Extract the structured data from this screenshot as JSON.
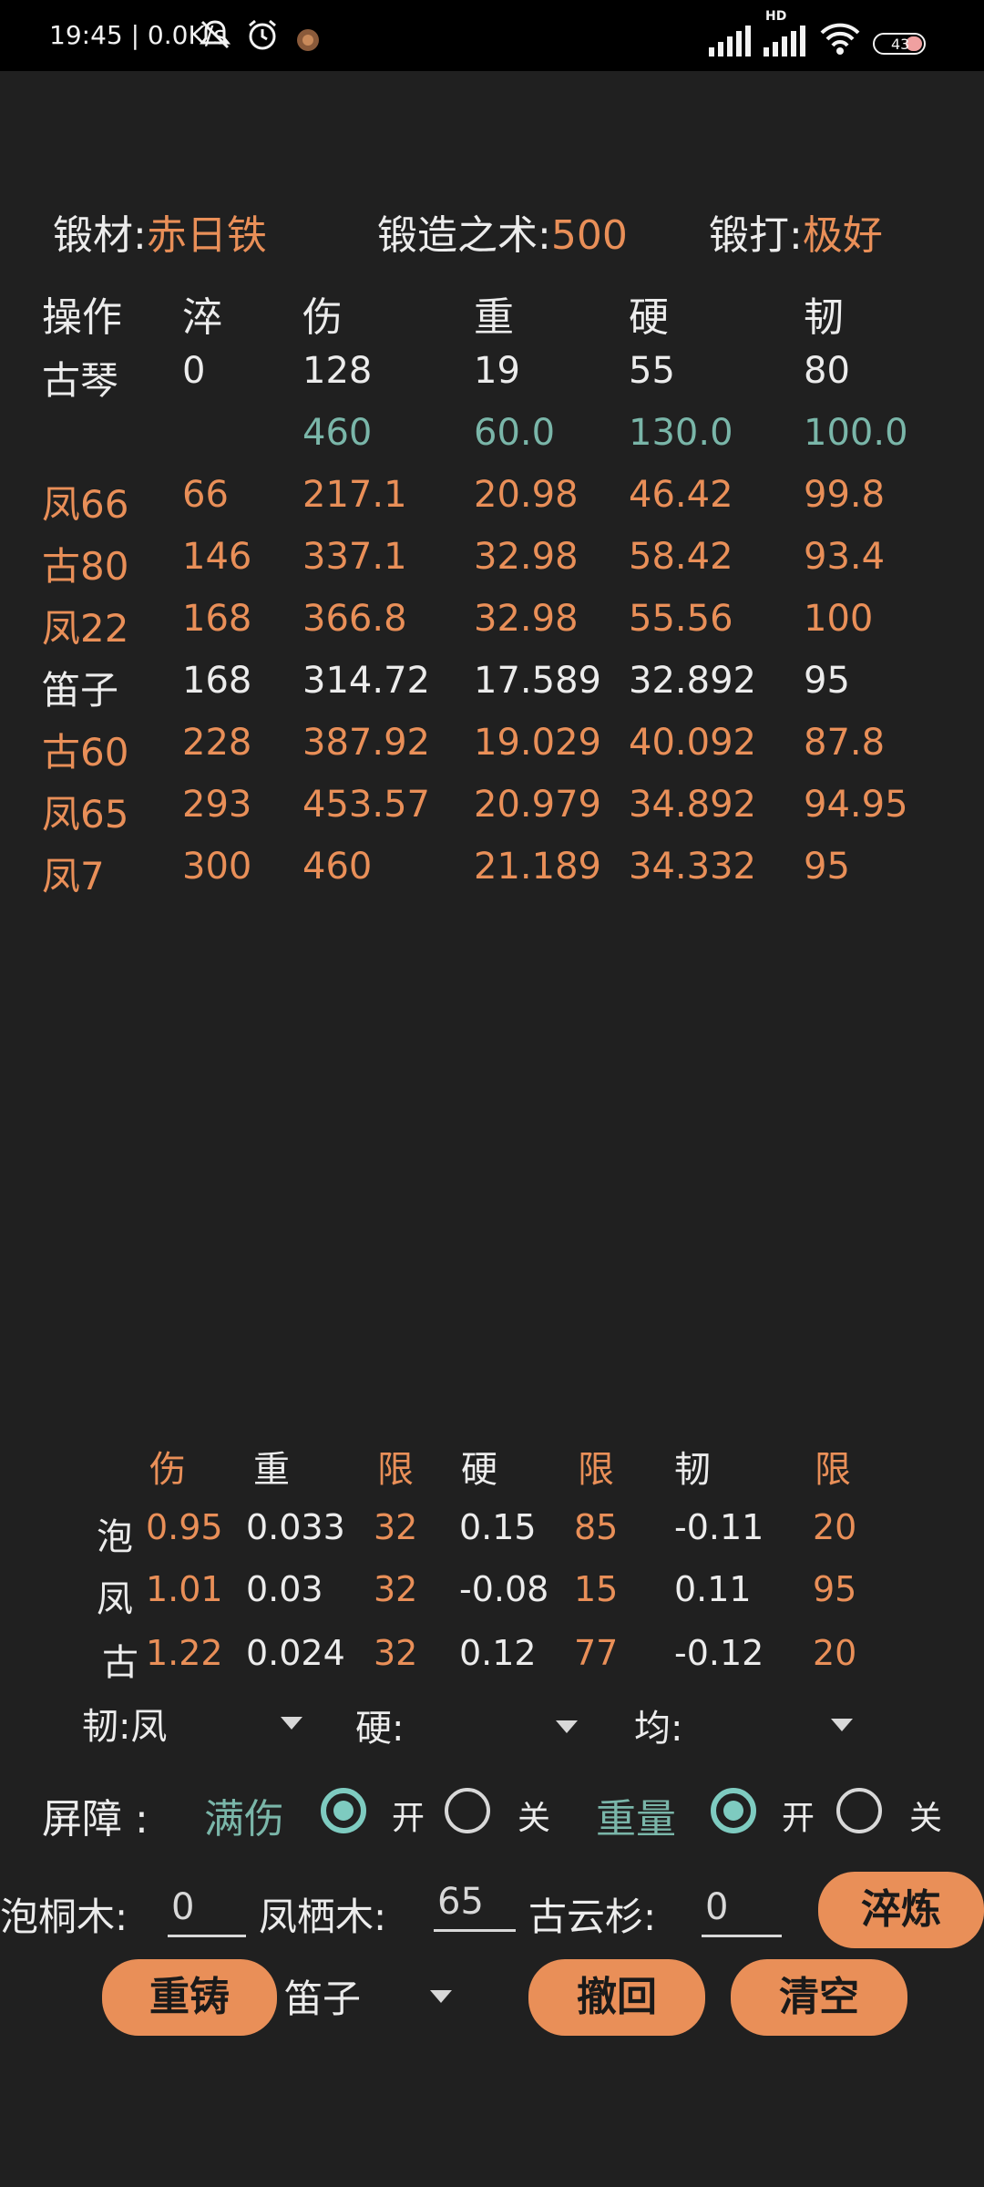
{
  "status_bar": {
    "time": "19:45 | 0.0K/s",
    "battery": "43",
    "icons": [
      "mute-icon",
      "alarm-icon",
      "app-icon",
      "signal-icon",
      "hd-signal-icon",
      "wifi-icon",
      "battery-icon"
    ]
  },
  "header": {
    "material_label": "锻材:",
    "material_value": "赤日铁",
    "skill_label": "锻造之术:",
    "skill_value": "500",
    "forge_label": "锻打:",
    "forge_value": "极好"
  },
  "table": {
    "headers": [
      "操作",
      "淬",
      "伤",
      "重",
      "硬",
      "韧"
    ],
    "rows": [
      {
        "op": "古琴",
        "cui": "0",
        "shang": "128",
        "zhong": "19",
        "ying": "55",
        "ren": "80",
        "color": "white"
      },
      {
        "op": "",
        "cui": "",
        "shang": "460",
        "zhong": "60.0",
        "ying": "130.0",
        "ren": "100.0",
        "color": "teal"
      },
      {
        "op": "凤66",
        "cui": "66",
        "shang": "217.1",
        "zhong": "20.98",
        "ying": "46.42",
        "ren": "99.8",
        "color": "orange"
      },
      {
        "op": "古80",
        "cui": "146",
        "shang": "337.1",
        "zhong": "32.98",
        "ying": "58.42",
        "ren": "93.4",
        "color": "orange"
      },
      {
        "op": "凤22",
        "cui": "168",
        "shang": "366.8",
        "zhong": "32.98",
        "ying": "55.56",
        "ren": "100",
        "color": "orange"
      },
      {
        "op": "笛子",
        "cui": "168",
        "shang": "314.72",
        "zhong": "17.589",
        "ying": "32.892",
        "ren": "95",
        "color": "white"
      },
      {
        "op": "古60",
        "cui": "228",
        "shang": "387.92",
        "zhong": "19.029",
        "ying": "40.092",
        "ren": "87.8",
        "color": "orange"
      },
      {
        "op": "凤65",
        "cui": "293",
        "shang": "453.57",
        "zhong": "20.979",
        "ying": "34.892",
        "ren": "94.95",
        "color": "orange"
      },
      {
        "op": "凤7",
        "cui": "300",
        "shang": "460",
        "zhong": "21.189",
        "ying": "34.332",
        "ren": "95",
        "color": "orange"
      }
    ]
  },
  "coef": {
    "headers": [
      "伤",
      "重",
      "限",
      "硬",
      "限",
      "韧",
      "限"
    ],
    "rows": [
      {
        "name": "泡",
        "shang": "0.95",
        "zhong": "0.033",
        "lim1": "32",
        "ying": "0.15",
        "lim2": "85",
        "ren": "-0.11",
        "lim3": "20"
      },
      {
        "name": "凤",
        "shang": "1.01",
        "zhong": "0.03",
        "lim1": "32",
        "ying": "-0.08",
        "lim2": "15",
        "ren": "0.11",
        "lim3": "95"
      },
      {
        "name": "古",
        "shang": "1.22",
        "zhong": "0.024",
        "lim1": "32",
        "ying": "0.12",
        "lim2": "77",
        "ren": "-0.12",
        "lim3": "20"
      }
    ]
  },
  "selectors": {
    "ren_label": "韧:凤",
    "ying_label": "硬:",
    "jun_label": "均:"
  },
  "barrier": {
    "label": "屏障 :",
    "full_damage": "满伤",
    "weight": "重量",
    "on": "开",
    "off": "关"
  },
  "woods": {
    "paotong_label": "泡桐木:",
    "paotong_value": "0",
    "fengqi_label": "凤栖木:",
    "fengqi_value": "65",
    "guyun_label": "古云杉:",
    "guyun_value": "0"
  },
  "buttons": {
    "quench": "淬炼",
    "recast": "重铸",
    "revoke": "撤回",
    "clear": "清空"
  },
  "recast_select": "笛子",
  "colors": {
    "orange": "#e98f58",
    "teal": "#7ab6a9",
    "background": "#202020"
  }
}
